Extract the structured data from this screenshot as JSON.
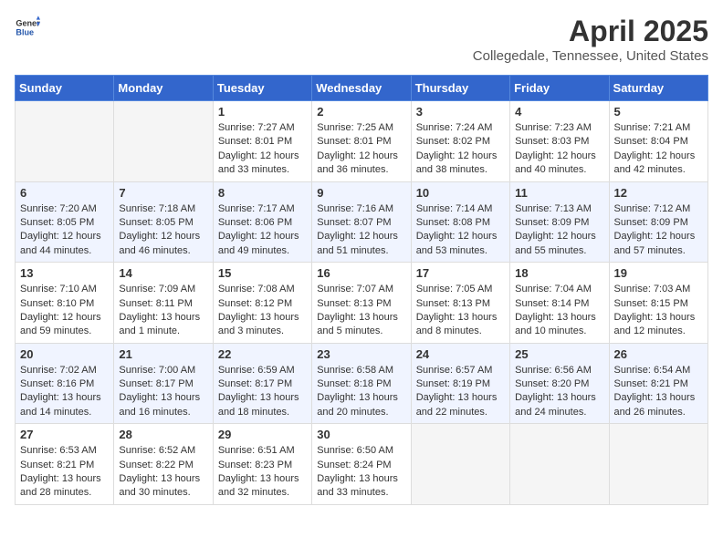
{
  "header": {
    "logo_general": "General",
    "logo_blue": "Blue",
    "month": "April 2025",
    "location": "Collegedale, Tennessee, United States"
  },
  "weekdays": [
    "Sunday",
    "Monday",
    "Tuesday",
    "Wednesday",
    "Thursday",
    "Friday",
    "Saturday"
  ],
  "weeks": [
    [
      {
        "day": "",
        "empty": true
      },
      {
        "day": "",
        "empty": true
      },
      {
        "day": "1",
        "sunrise": "7:27 AM",
        "sunset": "8:01 PM",
        "daylight": "12 hours and 33 minutes."
      },
      {
        "day": "2",
        "sunrise": "7:25 AM",
        "sunset": "8:01 PM",
        "daylight": "12 hours and 36 minutes."
      },
      {
        "day": "3",
        "sunrise": "7:24 AM",
        "sunset": "8:02 PM",
        "daylight": "12 hours and 38 minutes."
      },
      {
        "day": "4",
        "sunrise": "7:23 AM",
        "sunset": "8:03 PM",
        "daylight": "12 hours and 40 minutes."
      },
      {
        "day": "5",
        "sunrise": "7:21 AM",
        "sunset": "8:04 PM",
        "daylight": "12 hours and 42 minutes."
      }
    ],
    [
      {
        "day": "6",
        "sunrise": "7:20 AM",
        "sunset": "8:05 PM",
        "daylight": "12 hours and 44 minutes."
      },
      {
        "day": "7",
        "sunrise": "7:18 AM",
        "sunset": "8:05 PM",
        "daylight": "12 hours and 46 minutes."
      },
      {
        "day": "8",
        "sunrise": "7:17 AM",
        "sunset": "8:06 PM",
        "daylight": "12 hours and 49 minutes."
      },
      {
        "day": "9",
        "sunrise": "7:16 AM",
        "sunset": "8:07 PM",
        "daylight": "12 hours and 51 minutes."
      },
      {
        "day": "10",
        "sunrise": "7:14 AM",
        "sunset": "8:08 PM",
        "daylight": "12 hours and 53 minutes."
      },
      {
        "day": "11",
        "sunrise": "7:13 AM",
        "sunset": "8:09 PM",
        "daylight": "12 hours and 55 minutes."
      },
      {
        "day": "12",
        "sunrise": "7:12 AM",
        "sunset": "8:09 PM",
        "daylight": "12 hours and 57 minutes."
      }
    ],
    [
      {
        "day": "13",
        "sunrise": "7:10 AM",
        "sunset": "8:10 PM",
        "daylight": "12 hours and 59 minutes."
      },
      {
        "day": "14",
        "sunrise": "7:09 AM",
        "sunset": "8:11 PM",
        "daylight": "13 hours and 1 minute."
      },
      {
        "day": "15",
        "sunrise": "7:08 AM",
        "sunset": "8:12 PM",
        "daylight": "13 hours and 3 minutes."
      },
      {
        "day": "16",
        "sunrise": "7:07 AM",
        "sunset": "8:13 PM",
        "daylight": "13 hours and 5 minutes."
      },
      {
        "day": "17",
        "sunrise": "7:05 AM",
        "sunset": "8:13 PM",
        "daylight": "13 hours and 8 minutes."
      },
      {
        "day": "18",
        "sunrise": "7:04 AM",
        "sunset": "8:14 PM",
        "daylight": "13 hours and 10 minutes."
      },
      {
        "day": "19",
        "sunrise": "7:03 AM",
        "sunset": "8:15 PM",
        "daylight": "13 hours and 12 minutes."
      }
    ],
    [
      {
        "day": "20",
        "sunrise": "7:02 AM",
        "sunset": "8:16 PM",
        "daylight": "13 hours and 14 minutes."
      },
      {
        "day": "21",
        "sunrise": "7:00 AM",
        "sunset": "8:17 PM",
        "daylight": "13 hours and 16 minutes."
      },
      {
        "day": "22",
        "sunrise": "6:59 AM",
        "sunset": "8:17 PM",
        "daylight": "13 hours and 18 minutes."
      },
      {
        "day": "23",
        "sunrise": "6:58 AM",
        "sunset": "8:18 PM",
        "daylight": "13 hours and 20 minutes."
      },
      {
        "day": "24",
        "sunrise": "6:57 AM",
        "sunset": "8:19 PM",
        "daylight": "13 hours and 22 minutes."
      },
      {
        "day": "25",
        "sunrise": "6:56 AM",
        "sunset": "8:20 PM",
        "daylight": "13 hours and 24 minutes."
      },
      {
        "day": "26",
        "sunrise": "6:54 AM",
        "sunset": "8:21 PM",
        "daylight": "13 hours and 26 minutes."
      }
    ],
    [
      {
        "day": "27",
        "sunrise": "6:53 AM",
        "sunset": "8:21 PM",
        "daylight": "13 hours and 28 minutes."
      },
      {
        "day": "28",
        "sunrise": "6:52 AM",
        "sunset": "8:22 PM",
        "daylight": "13 hours and 30 minutes."
      },
      {
        "day": "29",
        "sunrise": "6:51 AM",
        "sunset": "8:23 PM",
        "daylight": "13 hours and 32 minutes."
      },
      {
        "day": "30",
        "sunrise": "6:50 AM",
        "sunset": "8:24 PM",
        "daylight": "13 hours and 33 minutes."
      },
      {
        "day": "",
        "empty": true
      },
      {
        "day": "",
        "empty": true
      },
      {
        "day": "",
        "empty": true
      }
    ]
  ]
}
